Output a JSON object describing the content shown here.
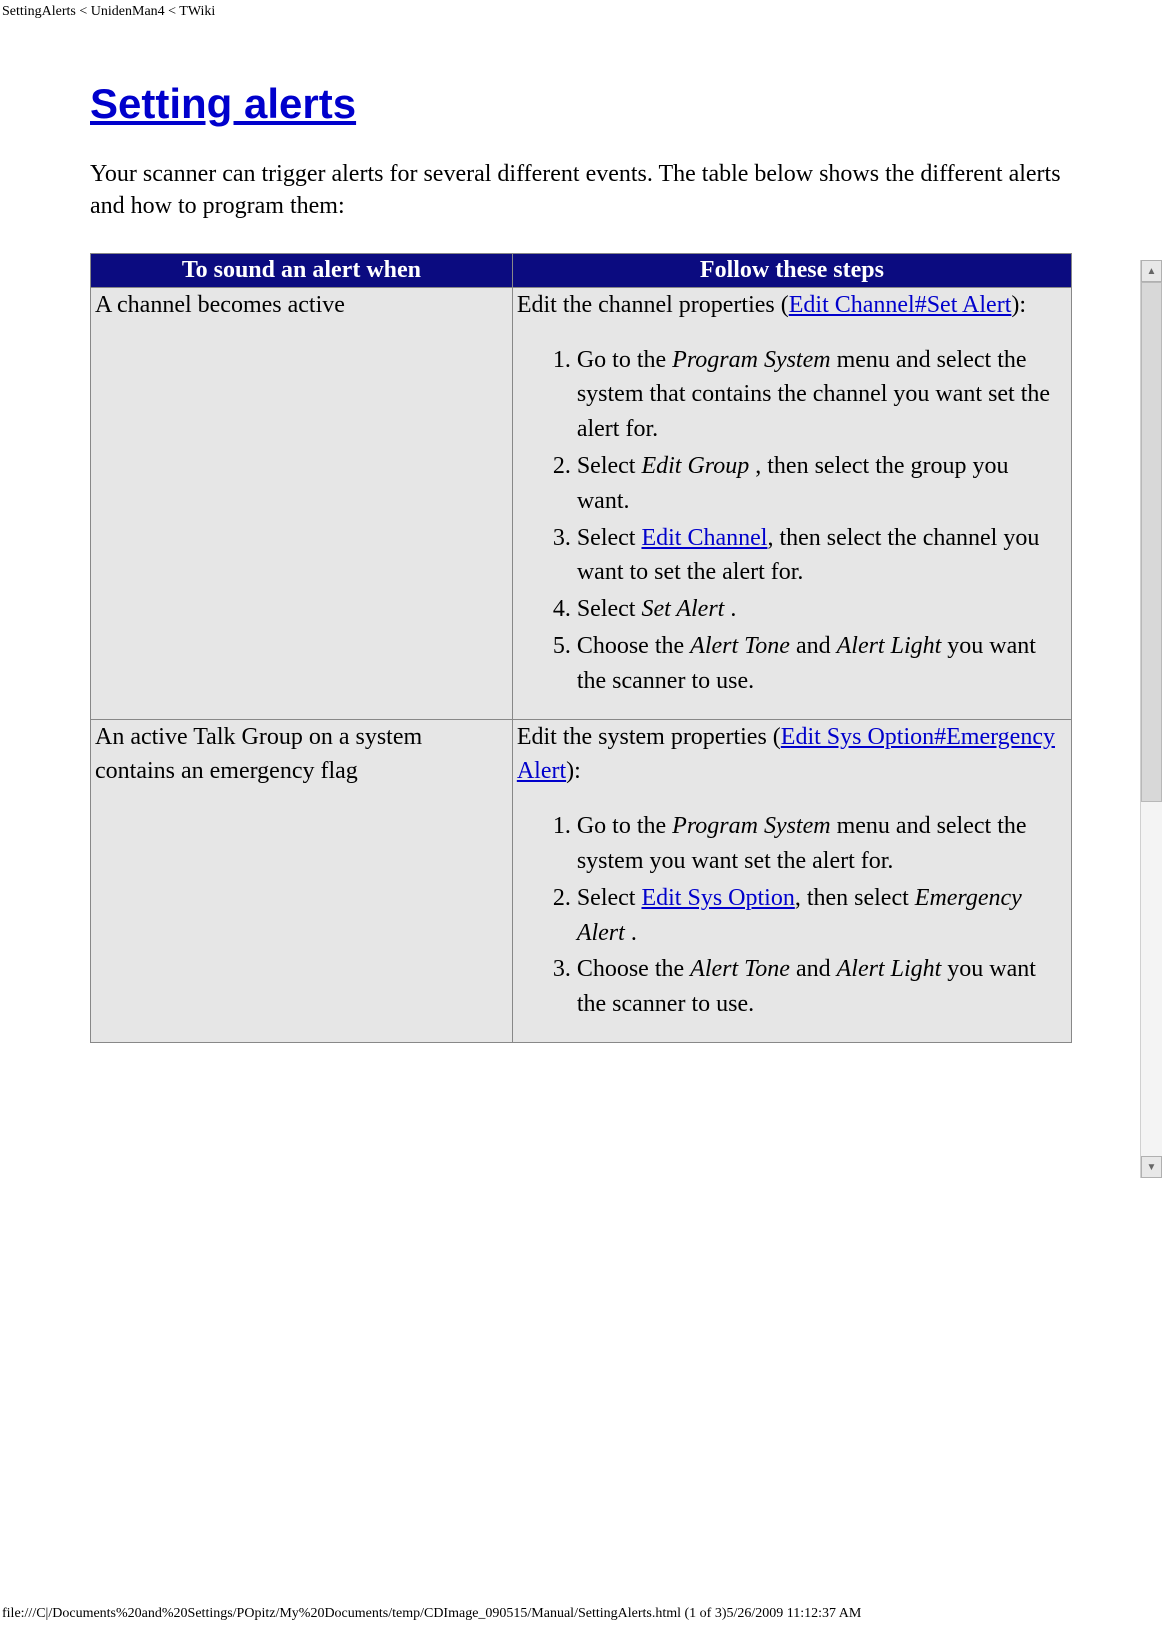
{
  "header": {
    "path": "SettingAlerts < UnidenMan4 < TWiki"
  },
  "title": "Setting alerts",
  "intro": "Your scanner can trigger alerts for several different events. The table below shows the different alerts and how to program them:",
  "table": {
    "head": {
      "col1": "To sound an alert when",
      "col2": "Follow these steps"
    },
    "rows": [
      {
        "trigger": "A channel becomes active",
        "lead_pre": "Edit the channel properties (",
        "lead_link": "Edit Channel#Set Alert",
        "lead_post": "):",
        "steps": [
          {
            "pre": "Go to the ",
            "em": "Program System",
            "post": " menu and select the system that contains the channel you want set the alert for."
          },
          {
            "pre": "Select ",
            "em": "Edit Group",
            "post": " , then select the group you want."
          },
          {
            "pre": "Select ",
            "link": "Edit Channel",
            "post": ", then select the channel you want to set the alert for."
          },
          {
            "pre": "Select ",
            "em": "Set Alert",
            "post": " ."
          },
          {
            "pre": "Choose the ",
            "em": "Alert Tone",
            "mid": " and ",
            "em2": "Alert Light",
            "post": " you want the scanner to use."
          }
        ]
      },
      {
        "trigger": "An active Talk Group on a system contains an emergency flag",
        "lead_pre": "Edit the system properties (",
        "lead_link": "Edit Sys Option#Emergency Alert",
        "lead_post": "):",
        "steps": [
          {
            "pre": "Go to the ",
            "em": "Program System",
            "post": " menu and select the system you want set the alert for."
          },
          {
            "pre": "Select ",
            "link": "Edit Sys Option",
            "post": ", then select ",
            "em_after": "Emergency Alert",
            "tail": " ."
          },
          {
            "pre": "Choose the ",
            "em": "Alert Tone",
            "mid": " and ",
            "em2": "Alert Light",
            "post": " you want the scanner to use."
          }
        ]
      }
    ]
  },
  "footer": {
    "path": "file:///C|/Documents%20and%20Settings/POpitz/My%20Documents/temp/CDImage_090515/Manual/SettingAlerts.html (1 of 3)5/26/2009 11:12:37 AM"
  }
}
